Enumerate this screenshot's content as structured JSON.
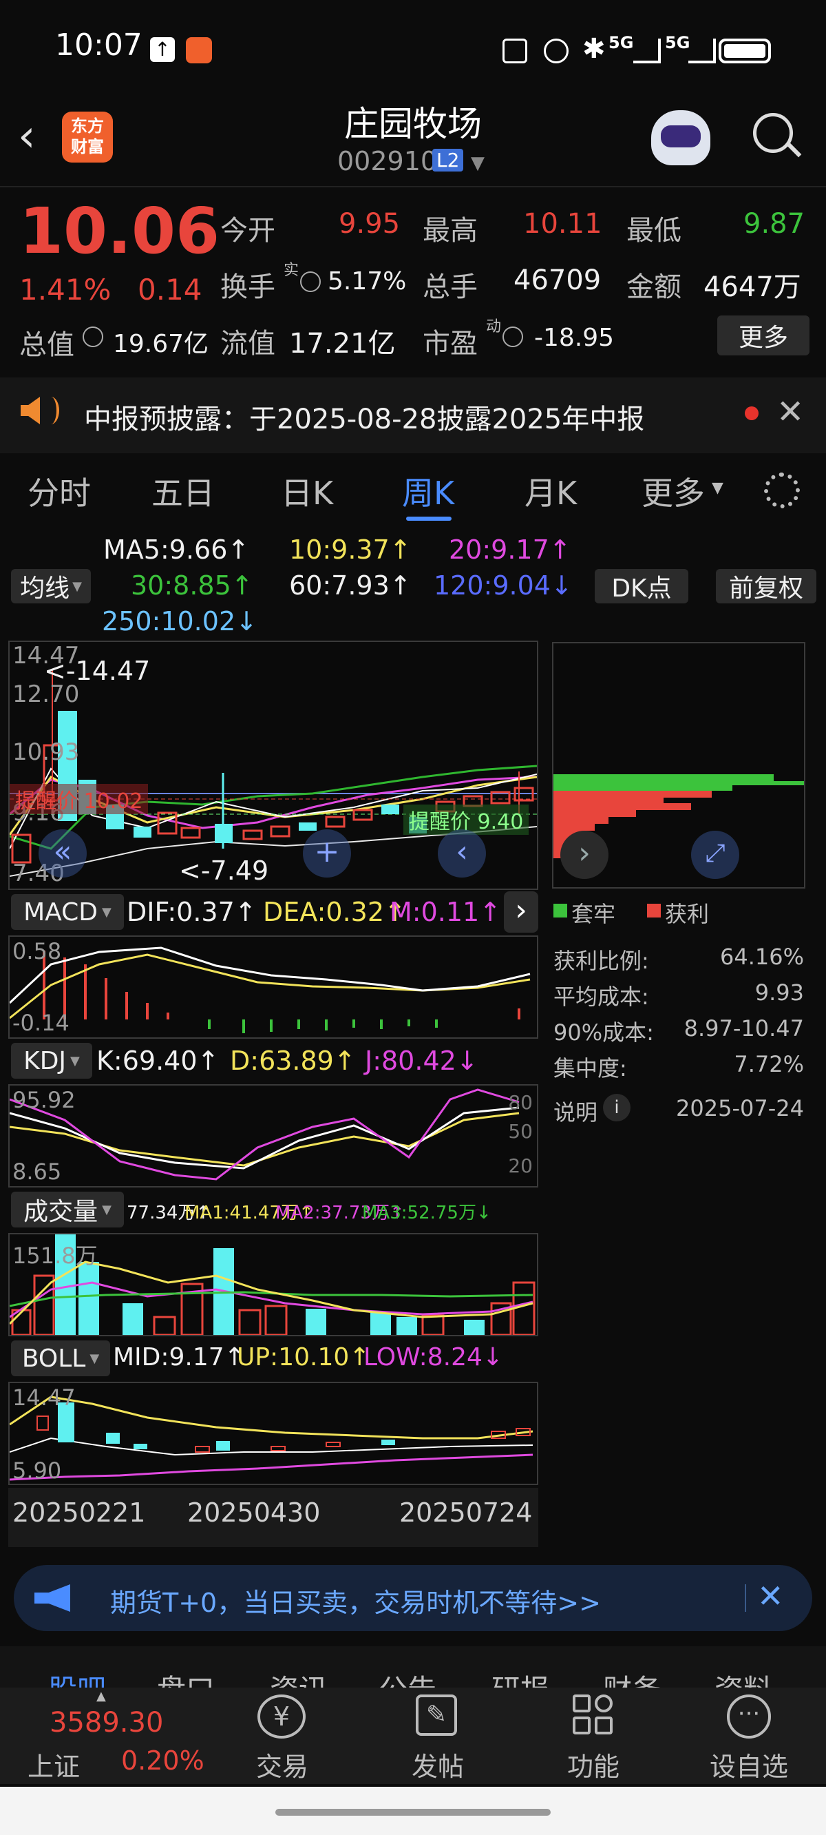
{
  "status_bar": {
    "time": "10:07",
    "net1": "5G",
    "net2": "5G"
  },
  "header": {
    "name": "庄园牧场",
    "code": "002910",
    "level": "L2",
    "logo_line1": "东方",
    "logo_line2": "财富"
  },
  "quote": {
    "price": "10.06",
    "pct": "1.41%",
    "chg": "0.14",
    "open_label": "今开",
    "open": "9.95",
    "high_label": "最高",
    "high": "10.11",
    "low_label": "最低",
    "low": "9.87",
    "turnover_label": "换手",
    "turnover_sup": "实",
    "turnover": "5.17%",
    "volume_label": "总手",
    "volume": "46709",
    "amount_label": "金额",
    "amount": "4647万",
    "mcap_label": "总值",
    "mcap": "19.67亿",
    "float_label": "流值",
    "float": "17.21亿",
    "pe_label": "市盈",
    "pe_sup": "动",
    "pe": "-18.95",
    "more_button": "更多"
  },
  "notice": {
    "text": "中报预披露：于2025-08-28披露2025年中报"
  },
  "tabs": [
    "分时",
    "五日",
    "日K",
    "周K",
    "月K",
    "更多"
  ],
  "active_tab": "周K",
  "ma": {
    "selector": "均线",
    "ma5": "MA5:9.66↑",
    "ma10": "10:9.37↑",
    "ma20": "20:9.17↑",
    "ma30": "30:8.85↑",
    "ma60": "60:7.93↑",
    "ma120": "120:9.04↓",
    "ma250": "250:10.02↓",
    "dk_button": "DK点",
    "adjust_button": "前复权"
  },
  "kline": {
    "top_tick": "14.47",
    "tick2": "12.70",
    "tick3": "10.93",
    "tick4": "9.16",
    "tick5": "7.40",
    "max_mark": "<-14.47",
    "min_mark": "<-7.49",
    "alert_red": "提醒价 10.02",
    "alert_green": "提醒价 9.40"
  },
  "macd": {
    "selector": "MACD",
    "dif": "DIF:0.37↑",
    "dea": "DEA:0.32↑",
    "m": "M:0.11↑",
    "top_tick": "0.58",
    "bot_tick": "-0.14"
  },
  "kdj": {
    "selector": "KDJ",
    "k": "K:69.40↑",
    "d": "D:63.89↑",
    "j": "J:80.42↓",
    "top_tick": "95.92",
    "bot_tick": "8.65",
    "lv80": "80",
    "lv50": "50",
    "lv20": "20"
  },
  "vol": {
    "selector": "成交量",
    "v": "77.34万↑",
    "ma1": "MA1:41.47万↑",
    "ma2": "MA2:37.73万↑",
    "ma3": "MA3:52.75万↓",
    "top_tick": "151.8万"
  },
  "boll": {
    "selector": "BOLL",
    "mid": "MID:9.17↑",
    "up": "UP:10.10↑",
    "low": "LOW:8.24↓",
    "top_tick": "14.47",
    "bot_tick": "5.90"
  },
  "dates": [
    "20250221",
    "20250430",
    "20250724"
  ],
  "chip": {
    "legend_trapped": "套牢",
    "legend_profit": "获利",
    "rows": [
      {
        "label": "获利比例:",
        "value": "64.16%"
      },
      {
        "label": "平均成本:",
        "value": "9.93"
      },
      {
        "label": "90%成本:",
        "value": "8.97-10.47"
      },
      {
        "label": "集中度:",
        "value": "7.72%"
      }
    ],
    "note_label": "说明",
    "note_date": "2025-07-24"
  },
  "ad": {
    "text": "期货T+0，当日买卖，交易时机不等待>>"
  },
  "sub_tabs_partial": [
    "股吧",
    "盘口",
    "资讯",
    "公告",
    "研报",
    "财务",
    "资料"
  ],
  "bottom": {
    "index_value": "3589.30",
    "index_name": "上证",
    "index_pct": "0.20%",
    "items": [
      "交易",
      "发帖",
      "功能",
      "设自选"
    ]
  },
  "colors": {
    "up": "#e8453c",
    "down": "#3cc33c",
    "accent": "#4a8cff",
    "cyan_bar": "#5ff0f0"
  }
}
